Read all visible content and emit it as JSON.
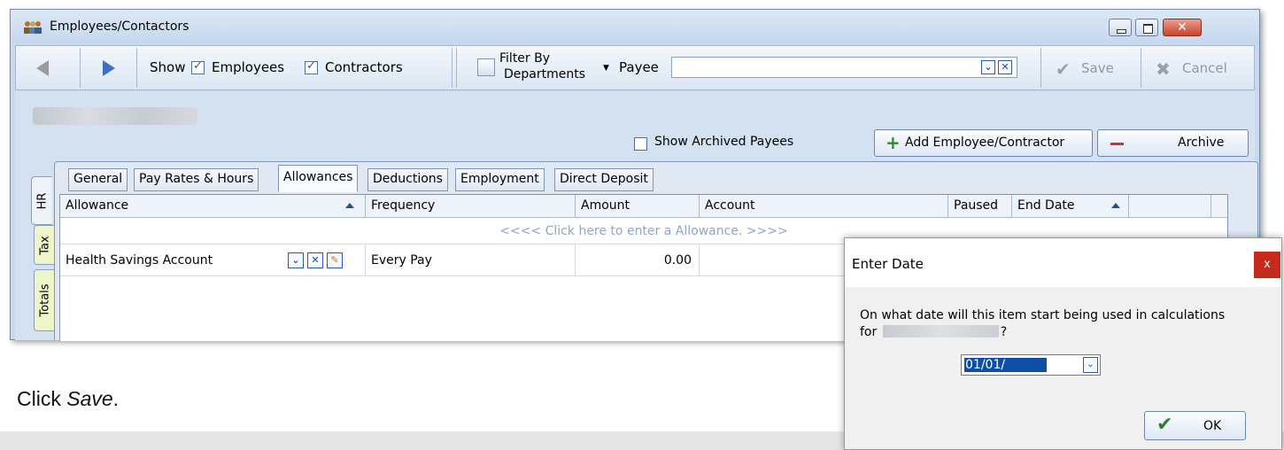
{
  "window": {
    "title": "Employees/Contactors"
  },
  "toolbar": {
    "show_label": "Show",
    "employees_label": "Employees",
    "employees_checked": true,
    "contractors_label": "Contractors",
    "contractors_checked": true,
    "filter_label_line1": "Filter By",
    "filter_label_line2": "Departments",
    "payee_label": "Payee",
    "payee_value": "",
    "save_label": "Save",
    "cancel_label": "Cancel"
  },
  "content": {
    "show_archived_label": "Show Archived Payees",
    "show_archived_checked": false,
    "add_label": "Add Employee/Contractor",
    "archive_label": "Archive"
  },
  "side_tabs": [
    "HR",
    "Tax",
    "Totals"
  ],
  "tabs": [
    {
      "label": "General",
      "active": false
    },
    {
      "label": "Pay Rates & Hours",
      "active": false
    },
    {
      "label": "Allowances",
      "active": true
    },
    {
      "label": "Deductions",
      "active": false
    },
    {
      "label": "Employment",
      "active": false
    },
    {
      "label": "Direct Deposit",
      "active": false
    }
  ],
  "grid": {
    "columns": [
      "Allowance",
      "Frequency",
      "Amount",
      "Account",
      "Paused",
      "End Date"
    ],
    "new_row_text": "<<<<   Click here to enter a Allowance.   >>>>",
    "rows": [
      {
        "allowance": "Health Savings Account",
        "frequency": "Every Pay",
        "amount": "0.00",
        "account": "",
        "paused": "",
        "end_date": ""
      }
    ]
  },
  "caption": {
    "prefix": "Click ",
    "emphasis": "Save",
    "suffix": "."
  },
  "dialog": {
    "title": "Enter Date",
    "close_glyph": "x",
    "message_line1": "On what date will this item start being used in calculations",
    "message_for": "for",
    "message_end": "?",
    "date_value": "01/01/",
    "ok_label": "OK"
  },
  "colors": {
    "accent": "#2a5aa8",
    "close_red": "#c42b1c",
    "green": "#2e8b2e"
  }
}
